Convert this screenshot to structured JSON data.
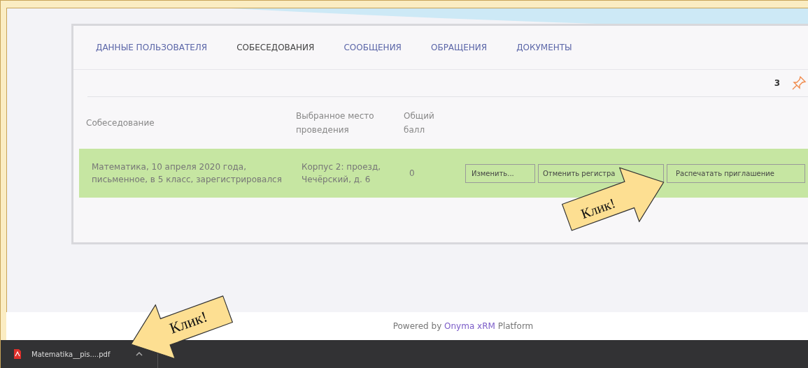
{
  "tabs": [
    {
      "label": "ДАННЫЕ ПОЛЬЗОВАТЕЛЯ",
      "selected": false
    },
    {
      "label": "СОБЕСЕДОВАНИЯ",
      "selected": true
    },
    {
      "label": "СООБЩЕНИЯ",
      "selected": false
    },
    {
      "label": "ОБРАЩЕНИЯ",
      "selected": false
    },
    {
      "label": "ДОКУМЕНТЫ",
      "selected": false
    }
  ],
  "toolbar": {
    "count": "3"
  },
  "table": {
    "columns": [
      "Собеседование",
      "Выбранное место проведения",
      "Общий балл"
    ],
    "rows": [
      {
        "interview": "Математика, 10 апреля 2020 года, письменное, в 5 класс, зарегистрировался",
        "place": "Корпус 2: проезд, Чечёрский, д. 6",
        "score": "0",
        "selected": true,
        "buttons": [
          "Изменить...",
          "Отменить регистра",
          "Распечатать приглашение"
        ]
      }
    ]
  },
  "footer": {
    "prefix": "Powered by",
    "link": "Onyma xRM",
    "suffix": "Platform"
  },
  "downloads": [
    {
      "file": "Matematika__pis....pdf"
    }
  ],
  "callouts": [
    {
      "kind": "arrow-right",
      "text": "Клик!"
    },
    {
      "kind": "arrow-left",
      "text": "Клик!"
    }
  ]
}
